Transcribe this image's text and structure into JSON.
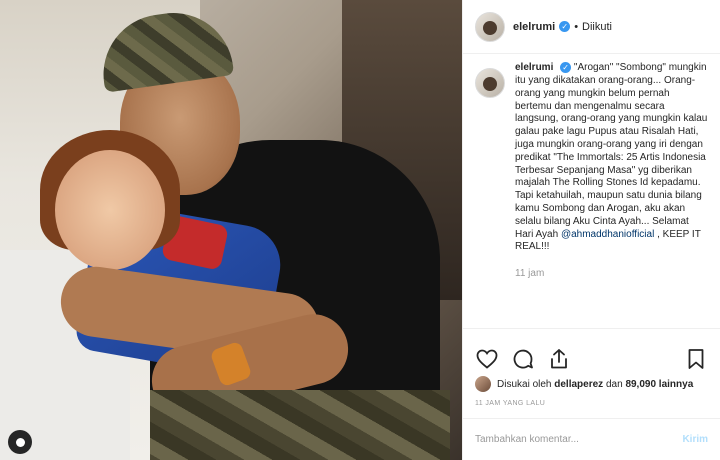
{
  "post": {
    "username": "elelrumi",
    "follow_status": "Diikuti",
    "separator": "•"
  },
  "caption": {
    "username": "elelrumi",
    "text": "\"Arogan\" \"Sombong\" mungkin itu yang dikatakan orang-orang... Orang-orang yang mungkin belum pernah bertemu dan mengenalmu secara langsung, orang-orang yang mungkin kalau galau pake lagu Pupus atau Risalah Hati, juga mungkin orang-orang yang iri dengan predikat \"The Immortals: 25 Artis Indonesia Terbesar Sepanjang Masa\" yg diberikan majalah The Rolling Stones Id kepadamu. Tapi ketahuilah, maupun satu dunia bilang kamu Sombong dan Arogan, aku akan selalu bilang Aku Cinta Ayah... Selamat Hari Ayah ",
    "mention": "@ahmaddhaniofficial",
    "suffix": " , KEEP IT REAL!!!",
    "time": "11 jam"
  },
  "likes": {
    "prefix": "Disukai oleh",
    "liker": "dellaperez",
    "middle": "dan",
    "count": "89,090 lainnya"
  },
  "timestamp": "11 JAM YANG LALU",
  "comment": {
    "placeholder": "Tambahkan komentar...",
    "send_label": "Kirim"
  },
  "icons": {
    "verified": "verified-badge-icon",
    "like": "heart-icon",
    "comment": "comment-icon",
    "share": "share-icon",
    "save": "bookmark-icon",
    "tag": "user-tag-icon"
  },
  "colors": {
    "verified": "#3897f0",
    "link": "#003569",
    "send_disabled": "#b2dffc",
    "muted": "#999999"
  }
}
